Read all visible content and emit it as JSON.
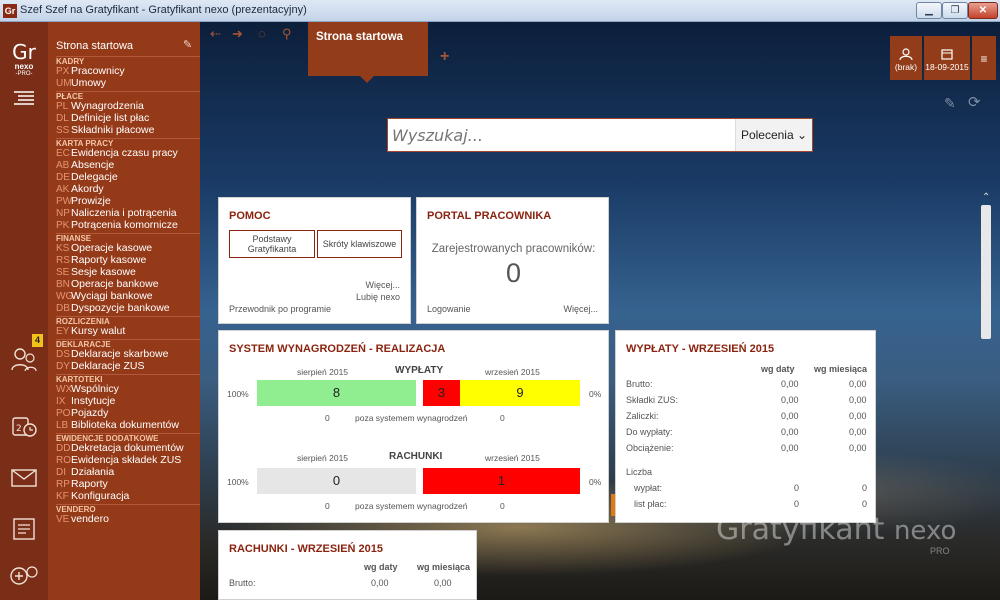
{
  "window": {
    "title": "Szef Szef na Gratyfikant - Gratyfikant nexo (prezentacyjny)",
    "controls": [
      "minimize",
      "maximize",
      "close"
    ]
  },
  "rail": {
    "logo": "Gr",
    "logo_sub": "nexo",
    "logo_pro": "-PRO-",
    "badge": "4"
  },
  "sidebar": {
    "start": "Strona startowa",
    "sections": [
      {
        "head": "KADRY",
        "items": [
          {
            "code": "PX",
            "label": "Pracownicy"
          },
          {
            "code": "UM",
            "label": "Umowy"
          }
        ]
      },
      {
        "head": "PŁACE",
        "items": [
          {
            "code": "PL",
            "label": "Wynagrodzenia"
          },
          {
            "code": "DL",
            "label": "Definicje list płac"
          },
          {
            "code": "SS",
            "label": "Składniki płacowe"
          }
        ]
      },
      {
        "head": "KARTA PRACY",
        "items": [
          {
            "code": "EC",
            "label": "Ewidencja czasu pracy"
          },
          {
            "code": "AB",
            "label": "Absencje"
          },
          {
            "code": "DE",
            "label": "Delegacje"
          },
          {
            "code": "AK",
            "label": "Akordy"
          },
          {
            "code": "PW",
            "label": "Prowizje"
          },
          {
            "code": "NP",
            "label": "Naliczenia i potrącenia"
          },
          {
            "code": "PK",
            "label": "Potrącenia komornicze"
          }
        ]
      },
      {
        "head": "FINANSE",
        "items": [
          {
            "code": "KS",
            "label": "Operacje kasowe"
          },
          {
            "code": "RS",
            "label": "Raporty kasowe"
          },
          {
            "code": "SE",
            "label": "Sesje kasowe"
          },
          {
            "code": "BN",
            "label": "Operacje bankowe"
          },
          {
            "code": "WG",
            "label": "Wyciągi bankowe"
          },
          {
            "code": "DB",
            "label": "Dyspozycje bankowe"
          }
        ]
      },
      {
        "head": "ROZLICZENIA",
        "items": [
          {
            "code": "EY",
            "label": "Kursy walut"
          }
        ]
      },
      {
        "head": "DEKLARACJE",
        "items": [
          {
            "code": "DS",
            "label": "Deklaracje skarbowe"
          },
          {
            "code": "DY",
            "label": "Deklaracje ZUS"
          }
        ]
      },
      {
        "head": "KARTOTEKI",
        "items": [
          {
            "code": "WX",
            "label": "Wspólnicy"
          },
          {
            "code": "IX",
            "label": "Instytucje"
          },
          {
            "code": "PO",
            "label": "Pojazdy"
          },
          {
            "code": "LB",
            "label": "Biblioteka dokumentów"
          }
        ]
      },
      {
        "head": "EWIDENCJE DODATKOWE",
        "items": [
          {
            "code": "DD",
            "label": "Dekretacja dokumentów"
          },
          {
            "code": "RO",
            "label": "Ewidencja składek ZUS"
          },
          {
            "code": "DI",
            "label": "Działania"
          },
          {
            "code": "RP",
            "label": "Raporty"
          },
          {
            "code": "KF",
            "label": "Konfiguracja"
          }
        ]
      },
      {
        "head": "VENDERO",
        "items": [
          {
            "code": "VE",
            "label": "vendero"
          }
        ]
      }
    ]
  },
  "tab": {
    "label": "Strona startowa"
  },
  "topright": {
    "user": "(brak)",
    "date": "18-09-2015"
  },
  "search": {
    "placeholder": "Wyszukaj...",
    "command": "Polecenia"
  },
  "pomoc": {
    "title": "POMOC",
    "btn1": "Podstawy Gratyfikanta",
    "btn2": "Skróty klawiszowe",
    "more": "Więcej...",
    "like": "Lubię nexo",
    "guide": "Przewodnik po programie"
  },
  "portal": {
    "title": "PORTAL PRACOWNIKA",
    "caption": "Zarejestrowanych pracowników:",
    "count": "0",
    "login": "Logowanie",
    "more": "Więcej..."
  },
  "system": {
    "title": "SYSTEM WYNAGRODZEŃ - REALIZACJA",
    "wyplaty": {
      "label": "WYPŁATY",
      "left_month": "sierpień 2015",
      "right_month": "wrzesień 2015",
      "left_pct": "100%",
      "right_pct": "0%",
      "left_val": "8",
      "mid_val": "3",
      "right_val": "9",
      "under_left": "0",
      "under_mid": "poza systemem wynagrodzeń",
      "under_right": "0"
    },
    "rachunki": {
      "label": "RACHUNKI",
      "left_month": "sierpień 2015",
      "right_month": "wrzesień 2015",
      "left_pct": "100%",
      "right_pct": "0%",
      "left_val": "0",
      "right_val": "1",
      "under_left": "0",
      "under_mid": "poza systemem wynagrodzeń",
      "under_right": "0"
    }
  },
  "wyplaty_sep": {
    "title": "WYPŁATY - WRZESIEŃ 2015",
    "col1": "wg daty",
    "col2": "wg miesiąca",
    "rows": [
      {
        "label": "Brutto:",
        "a": "0,00",
        "b": "0,00"
      },
      {
        "label": "Składki ZUS:",
        "a": "0,00",
        "b": "0,00"
      },
      {
        "label": "Zaliczki:",
        "a": "0,00",
        "b": "0,00"
      },
      {
        "label": "Do wypłaty:",
        "a": "0,00",
        "b": "0,00"
      },
      {
        "label": "Obciążenie:",
        "a": "0,00",
        "b": "0,00"
      }
    ],
    "liczba": "Liczba",
    "count_rows": [
      {
        "label": "wypłat:",
        "a": "0",
        "b": "0"
      },
      {
        "label": "list płac:",
        "a": "0",
        "b": "0"
      }
    ]
  },
  "rachunki_sep": {
    "title": "RACHUNKI - WRZESIEŃ 2015",
    "col1": "wg daty",
    "col2": "wg miesiąca",
    "row_label": "Brutto:",
    "a": "0,00",
    "b": "0,00"
  },
  "brand": {
    "name": "Gratyfikant",
    "nexo": "nexo",
    "pro": "PRO"
  },
  "colors": {
    "sidebar": "#953a19",
    "rail": "#7a2e18",
    "accent": "#8a2410",
    "green": "#90ee90",
    "red": "#ff0000",
    "yellow": "#ffff00"
  }
}
